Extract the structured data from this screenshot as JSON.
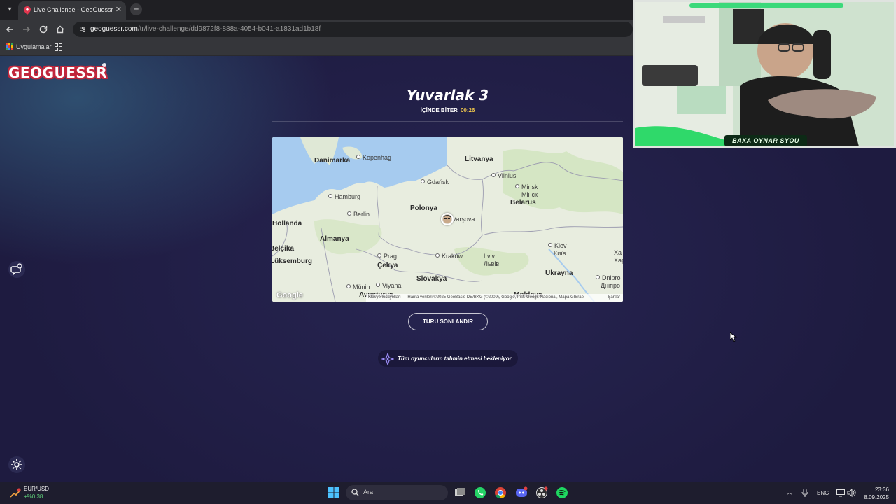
{
  "browser": {
    "tab_title": "Live Challenge - GeoGuessr",
    "tab_close": "✕",
    "new_tab": "+",
    "url_domain": "geoguessr.com",
    "url_path": "/tr/live-challenge/dd9872f8-888a-4054-b041-a1831ad1b18f",
    "bookmark_label": "Uygulamalar"
  },
  "page": {
    "logo_text": "GEOGUESSR",
    "round_title": "Yuvarlak 3",
    "timer_label": "İÇİNDE BİTER",
    "timer_value": "00:26",
    "end_button": "TURU SONLANDIR",
    "waiting_text": "Tüm oyuncuların tahmin etmesi bekleniyor"
  },
  "map": {
    "labels": {
      "danimarka": "Danimarka",
      "kopenhag": "Kopenhag",
      "litvanya": "Litvanya",
      "vilnius": "Vilnius",
      "minsk": "Minsk",
      "minsk_cy": "Мінск",
      "belarus": "Belarus",
      "gdansk": "Gdańsk",
      "hamburg": "Hamburg",
      "berlin": "Berlin",
      "polonya": "Polonya",
      "varsova": "Varşova",
      "hollanda": "Hollanda",
      "almanya": "Almanya",
      "belcika": "Belçika",
      "luksemburg": "Lüksemburg",
      "prag": "Prag",
      "cekya": "Çekya",
      "krakow": "Kraków",
      "lviv": "Lviv",
      "lviv_cy": "Львів",
      "kiev": "Kiev",
      "kiev_cy": "Київ",
      "ukrayna": "Ukrayna",
      "slovakya": "Slovakya",
      "munih": "Münih",
      "viyana": "Viyana",
      "dnipro": "Dnipro",
      "dnipro_cy": "Дніпро",
      "khar_partial": "Ха",
      "kh_partial": "Хар",
      "avusturya_partial": "Avusturya",
      "moldova_partial": "Moldova"
    },
    "google": "Google",
    "attribution_left": "Klavye kısayolları",
    "attribution_data": "Harita verileri ©2025 GeoBasis-DE/BKG (©2009), Google, Inst. Geogr. Nacional, Mapa GISrael",
    "attribution_terms": "Şartlar"
  },
  "webcam": {
    "label": "BAXA OYNAR SYOU"
  },
  "taskbar": {
    "widget_pair": "EUR/USD",
    "widget_change": "+%0,38",
    "search_placeholder": "Ara",
    "language": "ENG",
    "time": "23:36",
    "date": "8.09.2025"
  },
  "colors": {
    "accent_yellow": "#f2c94c",
    "brand_red": "#c2273c",
    "page_bg": "#1e1b40"
  }
}
